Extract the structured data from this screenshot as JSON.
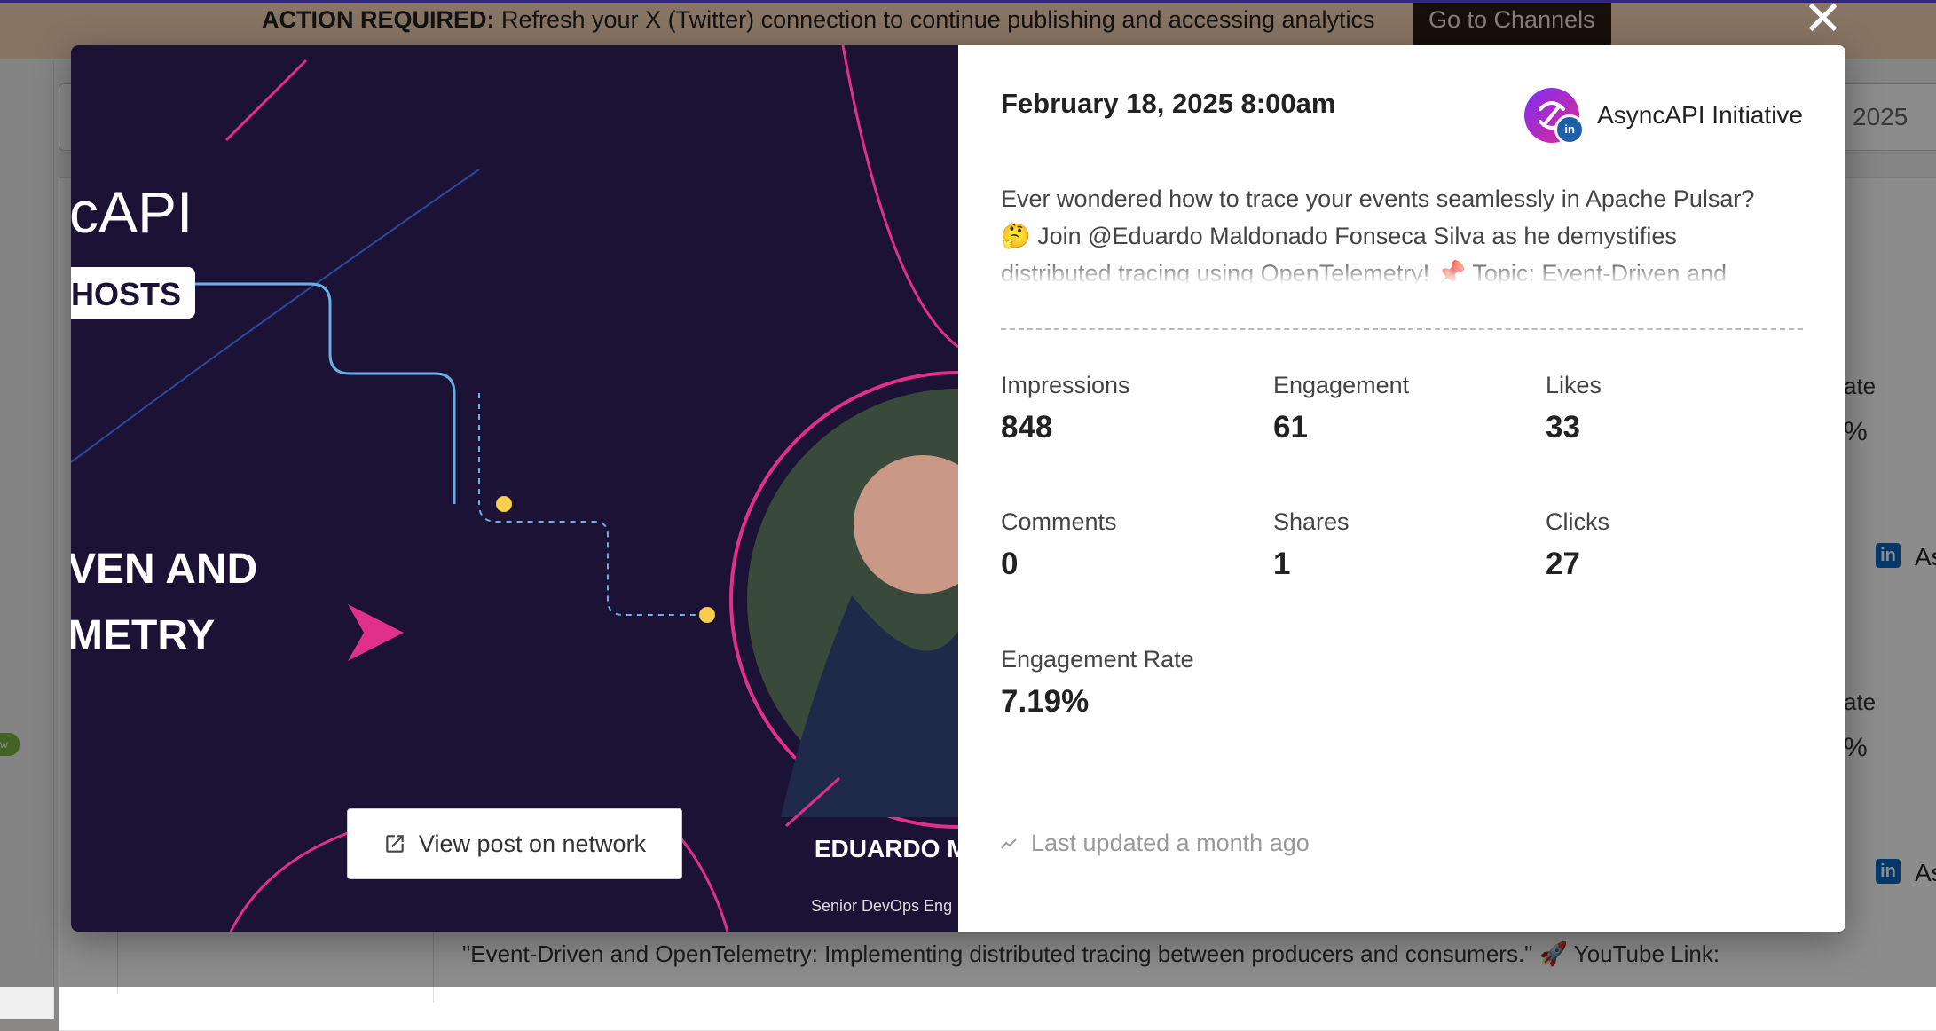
{
  "banner": {
    "bold": "ACTION REQUIRED:",
    "text": " Refresh your X (Twitter) connection to continue publishing and accessing analytics",
    "button": "Go to Channels"
  },
  "background": {
    "date_fragment": "2025",
    "rate_label": "ate",
    "pct": "%",
    "acct_fragment": "As",
    "post_line": "\"Event-Driven and OpenTelemetry: Implementing distributed tracing between producers and consumers.\" 🚀 YouTube Link:",
    "badge": "w"
  },
  "modal": {
    "close": "✕",
    "media": {
      "line1": "cAPI",
      "hosts": "HOSTS",
      "line2": "VEN AND",
      "line3": "METRY",
      "name": "EDUARDO M FONSEC",
      "role": "Senior DevOps Eng",
      "view_button": "View post on network"
    },
    "date": "February 18, 2025 8:00am",
    "account": "AsyncAPI Initiative",
    "post_text": "Ever wondered how to trace your events seamlessly in Apache Pulsar? 🤔 Join @Eduardo Maldonado Fonseca Silva as he demystifies distributed tracing using OpenTelemetry! 📌 Topic: Event-Driven and",
    "stats": {
      "impressions_label": "Impressions",
      "impressions": "848",
      "engagement_label": "Engagement",
      "engagement": "61",
      "likes_label": "Likes",
      "likes": "33",
      "comments_label": "Comments",
      "comments": "0",
      "shares_label": "Shares",
      "shares": "1",
      "clicks_label": "Clicks",
      "clicks": "27",
      "rate_label": "Engagement Rate",
      "rate": "7.19%"
    },
    "updated": "Last updated a month ago"
  },
  "colors": {
    "banner_bg": "#f6d4b4",
    "media_bg": "#1c1236",
    "accent_pink": "#e0308a",
    "accent_blue": "#6ab0e6",
    "accent_yellow": "#f6cc4a",
    "linkedin": "#1f5fa8"
  },
  "icons": {
    "close": "close-icon",
    "external": "external-link-icon",
    "trend": "trend-icon",
    "linkedin": "linkedin-icon"
  }
}
